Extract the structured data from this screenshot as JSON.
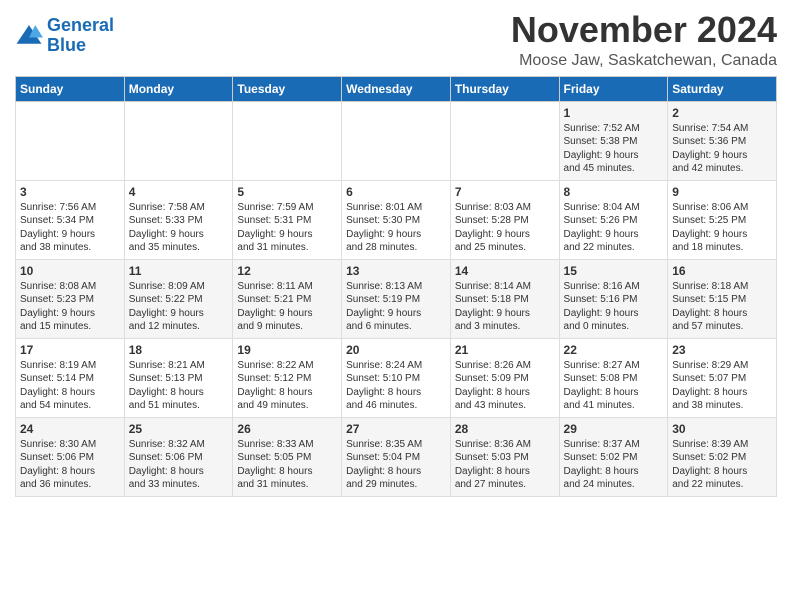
{
  "logo": {
    "line1": "General",
    "line2": "Blue"
  },
  "title": "November 2024",
  "location": "Moose Jaw, Saskatchewan, Canada",
  "weekdays": [
    "Sunday",
    "Monday",
    "Tuesday",
    "Wednesday",
    "Thursday",
    "Friday",
    "Saturday"
  ],
  "weeks": [
    [
      {
        "day": "",
        "info": ""
      },
      {
        "day": "",
        "info": ""
      },
      {
        "day": "",
        "info": ""
      },
      {
        "day": "",
        "info": ""
      },
      {
        "day": "",
        "info": ""
      },
      {
        "day": "1",
        "info": "Sunrise: 7:52 AM\nSunset: 5:38 PM\nDaylight: 9 hours\nand 45 minutes."
      },
      {
        "day": "2",
        "info": "Sunrise: 7:54 AM\nSunset: 5:36 PM\nDaylight: 9 hours\nand 42 minutes."
      }
    ],
    [
      {
        "day": "3",
        "info": "Sunrise: 7:56 AM\nSunset: 5:34 PM\nDaylight: 9 hours\nand 38 minutes."
      },
      {
        "day": "4",
        "info": "Sunrise: 7:58 AM\nSunset: 5:33 PM\nDaylight: 9 hours\nand 35 minutes."
      },
      {
        "day": "5",
        "info": "Sunrise: 7:59 AM\nSunset: 5:31 PM\nDaylight: 9 hours\nand 31 minutes."
      },
      {
        "day": "6",
        "info": "Sunrise: 8:01 AM\nSunset: 5:30 PM\nDaylight: 9 hours\nand 28 minutes."
      },
      {
        "day": "7",
        "info": "Sunrise: 8:03 AM\nSunset: 5:28 PM\nDaylight: 9 hours\nand 25 minutes."
      },
      {
        "day": "8",
        "info": "Sunrise: 8:04 AM\nSunset: 5:26 PM\nDaylight: 9 hours\nand 22 minutes."
      },
      {
        "day": "9",
        "info": "Sunrise: 8:06 AM\nSunset: 5:25 PM\nDaylight: 9 hours\nand 18 minutes."
      }
    ],
    [
      {
        "day": "10",
        "info": "Sunrise: 8:08 AM\nSunset: 5:23 PM\nDaylight: 9 hours\nand 15 minutes."
      },
      {
        "day": "11",
        "info": "Sunrise: 8:09 AM\nSunset: 5:22 PM\nDaylight: 9 hours\nand 12 minutes."
      },
      {
        "day": "12",
        "info": "Sunrise: 8:11 AM\nSunset: 5:21 PM\nDaylight: 9 hours\nand 9 minutes."
      },
      {
        "day": "13",
        "info": "Sunrise: 8:13 AM\nSunset: 5:19 PM\nDaylight: 9 hours\nand 6 minutes."
      },
      {
        "day": "14",
        "info": "Sunrise: 8:14 AM\nSunset: 5:18 PM\nDaylight: 9 hours\nand 3 minutes."
      },
      {
        "day": "15",
        "info": "Sunrise: 8:16 AM\nSunset: 5:16 PM\nDaylight: 9 hours\nand 0 minutes."
      },
      {
        "day": "16",
        "info": "Sunrise: 8:18 AM\nSunset: 5:15 PM\nDaylight: 8 hours\nand 57 minutes."
      }
    ],
    [
      {
        "day": "17",
        "info": "Sunrise: 8:19 AM\nSunset: 5:14 PM\nDaylight: 8 hours\nand 54 minutes."
      },
      {
        "day": "18",
        "info": "Sunrise: 8:21 AM\nSunset: 5:13 PM\nDaylight: 8 hours\nand 51 minutes."
      },
      {
        "day": "19",
        "info": "Sunrise: 8:22 AM\nSunset: 5:12 PM\nDaylight: 8 hours\nand 49 minutes."
      },
      {
        "day": "20",
        "info": "Sunrise: 8:24 AM\nSunset: 5:10 PM\nDaylight: 8 hours\nand 46 minutes."
      },
      {
        "day": "21",
        "info": "Sunrise: 8:26 AM\nSunset: 5:09 PM\nDaylight: 8 hours\nand 43 minutes."
      },
      {
        "day": "22",
        "info": "Sunrise: 8:27 AM\nSunset: 5:08 PM\nDaylight: 8 hours\nand 41 minutes."
      },
      {
        "day": "23",
        "info": "Sunrise: 8:29 AM\nSunset: 5:07 PM\nDaylight: 8 hours\nand 38 minutes."
      }
    ],
    [
      {
        "day": "24",
        "info": "Sunrise: 8:30 AM\nSunset: 5:06 PM\nDaylight: 8 hours\nand 36 minutes."
      },
      {
        "day": "25",
        "info": "Sunrise: 8:32 AM\nSunset: 5:06 PM\nDaylight: 8 hours\nand 33 minutes."
      },
      {
        "day": "26",
        "info": "Sunrise: 8:33 AM\nSunset: 5:05 PM\nDaylight: 8 hours\nand 31 minutes."
      },
      {
        "day": "27",
        "info": "Sunrise: 8:35 AM\nSunset: 5:04 PM\nDaylight: 8 hours\nand 29 minutes."
      },
      {
        "day": "28",
        "info": "Sunrise: 8:36 AM\nSunset: 5:03 PM\nDaylight: 8 hours\nand 27 minutes."
      },
      {
        "day": "29",
        "info": "Sunrise: 8:37 AM\nSunset: 5:02 PM\nDaylight: 8 hours\nand 24 minutes."
      },
      {
        "day": "30",
        "info": "Sunrise: 8:39 AM\nSunset: 5:02 PM\nDaylight: 8 hours\nand 22 minutes."
      }
    ]
  ]
}
